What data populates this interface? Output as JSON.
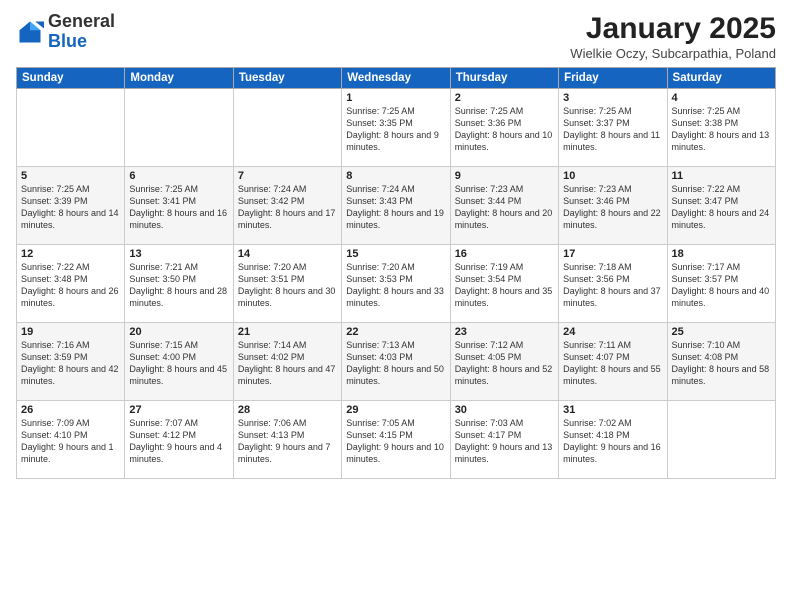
{
  "header": {
    "logo_general": "General",
    "logo_blue": "Blue",
    "month_title": "January 2025",
    "location": "Wielkie Oczy, Subcarpathia, Poland"
  },
  "days_of_week": [
    "Sunday",
    "Monday",
    "Tuesday",
    "Wednesday",
    "Thursday",
    "Friday",
    "Saturday"
  ],
  "weeks": [
    [
      {
        "day": "",
        "info": ""
      },
      {
        "day": "",
        "info": ""
      },
      {
        "day": "",
        "info": ""
      },
      {
        "day": "1",
        "info": "Sunrise: 7:25 AM\nSunset: 3:35 PM\nDaylight: 8 hours\nand 9 minutes."
      },
      {
        "day": "2",
        "info": "Sunrise: 7:25 AM\nSunset: 3:36 PM\nDaylight: 8 hours\nand 10 minutes."
      },
      {
        "day": "3",
        "info": "Sunrise: 7:25 AM\nSunset: 3:37 PM\nDaylight: 8 hours\nand 11 minutes."
      },
      {
        "day": "4",
        "info": "Sunrise: 7:25 AM\nSunset: 3:38 PM\nDaylight: 8 hours\nand 13 minutes."
      }
    ],
    [
      {
        "day": "5",
        "info": "Sunrise: 7:25 AM\nSunset: 3:39 PM\nDaylight: 8 hours\nand 14 minutes."
      },
      {
        "day": "6",
        "info": "Sunrise: 7:25 AM\nSunset: 3:41 PM\nDaylight: 8 hours\nand 16 minutes."
      },
      {
        "day": "7",
        "info": "Sunrise: 7:24 AM\nSunset: 3:42 PM\nDaylight: 8 hours\nand 17 minutes."
      },
      {
        "day": "8",
        "info": "Sunrise: 7:24 AM\nSunset: 3:43 PM\nDaylight: 8 hours\nand 19 minutes."
      },
      {
        "day": "9",
        "info": "Sunrise: 7:23 AM\nSunset: 3:44 PM\nDaylight: 8 hours\nand 20 minutes."
      },
      {
        "day": "10",
        "info": "Sunrise: 7:23 AM\nSunset: 3:46 PM\nDaylight: 8 hours\nand 22 minutes."
      },
      {
        "day": "11",
        "info": "Sunrise: 7:22 AM\nSunset: 3:47 PM\nDaylight: 8 hours\nand 24 minutes."
      }
    ],
    [
      {
        "day": "12",
        "info": "Sunrise: 7:22 AM\nSunset: 3:48 PM\nDaylight: 8 hours\nand 26 minutes."
      },
      {
        "day": "13",
        "info": "Sunrise: 7:21 AM\nSunset: 3:50 PM\nDaylight: 8 hours\nand 28 minutes."
      },
      {
        "day": "14",
        "info": "Sunrise: 7:20 AM\nSunset: 3:51 PM\nDaylight: 8 hours\nand 30 minutes."
      },
      {
        "day": "15",
        "info": "Sunrise: 7:20 AM\nSunset: 3:53 PM\nDaylight: 8 hours\nand 33 minutes."
      },
      {
        "day": "16",
        "info": "Sunrise: 7:19 AM\nSunset: 3:54 PM\nDaylight: 8 hours\nand 35 minutes."
      },
      {
        "day": "17",
        "info": "Sunrise: 7:18 AM\nSunset: 3:56 PM\nDaylight: 8 hours\nand 37 minutes."
      },
      {
        "day": "18",
        "info": "Sunrise: 7:17 AM\nSunset: 3:57 PM\nDaylight: 8 hours\nand 40 minutes."
      }
    ],
    [
      {
        "day": "19",
        "info": "Sunrise: 7:16 AM\nSunset: 3:59 PM\nDaylight: 8 hours\nand 42 minutes."
      },
      {
        "day": "20",
        "info": "Sunrise: 7:15 AM\nSunset: 4:00 PM\nDaylight: 8 hours\nand 45 minutes."
      },
      {
        "day": "21",
        "info": "Sunrise: 7:14 AM\nSunset: 4:02 PM\nDaylight: 8 hours\nand 47 minutes."
      },
      {
        "day": "22",
        "info": "Sunrise: 7:13 AM\nSunset: 4:03 PM\nDaylight: 8 hours\nand 50 minutes."
      },
      {
        "day": "23",
        "info": "Sunrise: 7:12 AM\nSunset: 4:05 PM\nDaylight: 8 hours\nand 52 minutes."
      },
      {
        "day": "24",
        "info": "Sunrise: 7:11 AM\nSunset: 4:07 PM\nDaylight: 8 hours\nand 55 minutes."
      },
      {
        "day": "25",
        "info": "Sunrise: 7:10 AM\nSunset: 4:08 PM\nDaylight: 8 hours\nand 58 minutes."
      }
    ],
    [
      {
        "day": "26",
        "info": "Sunrise: 7:09 AM\nSunset: 4:10 PM\nDaylight: 9 hours\nand 1 minute."
      },
      {
        "day": "27",
        "info": "Sunrise: 7:07 AM\nSunset: 4:12 PM\nDaylight: 9 hours\nand 4 minutes."
      },
      {
        "day": "28",
        "info": "Sunrise: 7:06 AM\nSunset: 4:13 PM\nDaylight: 9 hours\nand 7 minutes."
      },
      {
        "day": "29",
        "info": "Sunrise: 7:05 AM\nSunset: 4:15 PM\nDaylight: 9 hours\nand 10 minutes."
      },
      {
        "day": "30",
        "info": "Sunrise: 7:03 AM\nSunset: 4:17 PM\nDaylight: 9 hours\nand 13 minutes."
      },
      {
        "day": "31",
        "info": "Sunrise: 7:02 AM\nSunset: 4:18 PM\nDaylight: 9 hours\nand 16 minutes."
      },
      {
        "day": "",
        "info": ""
      }
    ]
  ]
}
